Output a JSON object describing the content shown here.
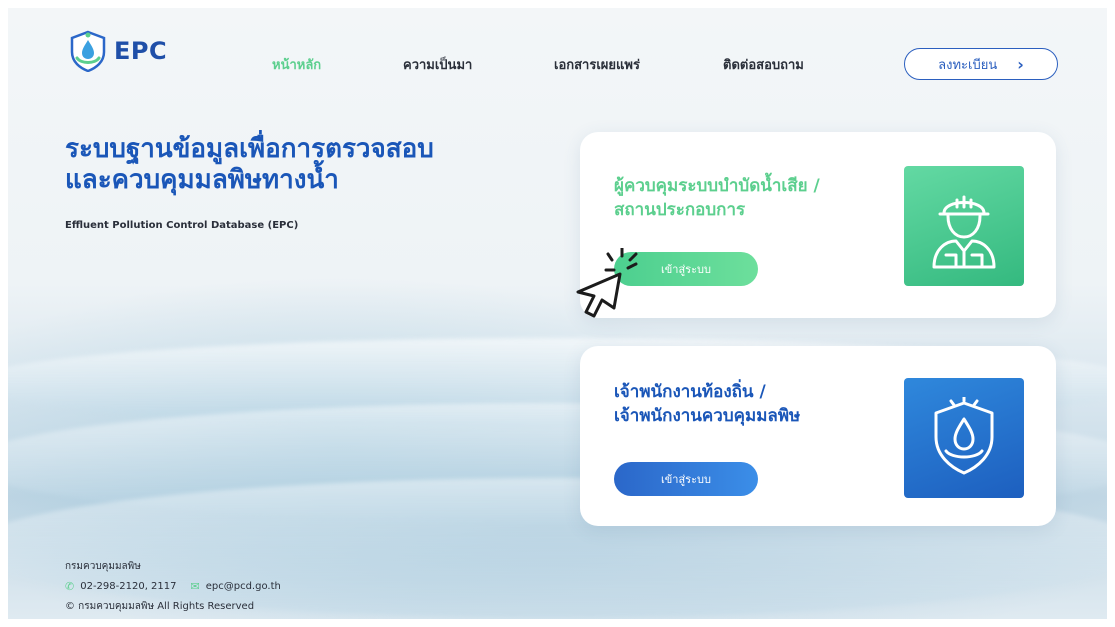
{
  "brand": {
    "name": "EPC"
  },
  "nav": {
    "home": "หน้าหลัก",
    "about": "ความเป็นมา",
    "documents": "เอกสารเผยแพร่",
    "contact": "ติดต่อสอบถาม"
  },
  "register": {
    "label": "ลงทะเบียน",
    "icon": "chevron-right-icon"
  },
  "hero": {
    "title_line1": "ระบบฐานข้อมูลเพื่อการตรวจสอบ",
    "title_line2": "และควบคุมมลพิษทางน้ำ",
    "subtitle": "Effluent Pollution Control Database (EPC)"
  },
  "cards": [
    {
      "title_line1": "ผู้ควบคุมระบบบำบัดน้ำเสีย /",
      "title_line2": "สถานประกอบการ",
      "button": "เข้าสู่ระบบ",
      "icon": "worker-icon",
      "accent": "#5ccf8e"
    },
    {
      "title_line1": "เจ้าพนักงานท้องถิ่น /",
      "title_line2": "เจ้าพนักงานควบคุมมลพิษ",
      "button": "เข้าสู่ระบบ",
      "icon": "water-shield-icon",
      "accent": "#1a56b8"
    }
  ],
  "footer": {
    "org": "กรมควบคุมมลพิษ",
    "phone": "02-298-2120, 2117",
    "email": "epc@pcd.go.th",
    "copyright": "© กรมควบคุมมลพิษ All Rights Reserved"
  }
}
